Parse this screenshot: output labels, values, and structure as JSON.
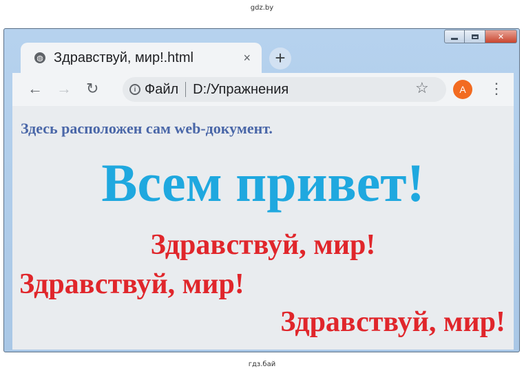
{
  "watermark": {
    "top": "gdz.by",
    "bottom": "гдз.бай"
  },
  "browser": {
    "tab_title": "Здравствуй, мир!.html",
    "tab_close_glyph": "×",
    "new_tab_glyph": "+",
    "address": {
      "scheme_label": "Файл",
      "url": "D:/Упражнения"
    },
    "profile_initial": "A",
    "accent_colors": {
      "profile": "#f26b21",
      "close_button": "#c9462f"
    }
  },
  "icons": {
    "back": "arrow-left-icon",
    "forward": "arrow-right-icon",
    "reload": "reload-icon",
    "info": "info-icon",
    "bookmark": "star-icon",
    "menu": "kebab-menu-icon",
    "tab_favicon": "globe-icon"
  },
  "page": {
    "intro": "Здесь расположен сам web-документ.",
    "heading": "Всем привет!",
    "hello_center": "Здравствуй, мир!",
    "hello_left": "Здравствуй, мир!",
    "hello_right": "Здравствуй, мир!",
    "colors": {
      "intro": "#4a67a8",
      "heading": "#1fa8df",
      "hello": "#e0262b"
    }
  }
}
